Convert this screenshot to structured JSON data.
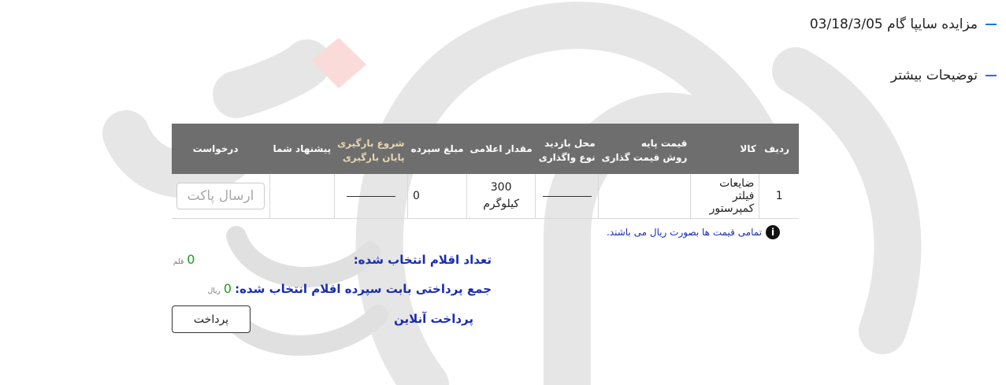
{
  "auction": {
    "title": "مزایده سایپا گام 03/18/3/05",
    "more_info": "توضیحات بیشتر"
  },
  "table": {
    "headers": {
      "row": "ردیف",
      "item": "کالا",
      "base_price": "قیمت پایه",
      "pricing_method": "روش قیمت گذاری",
      "visit_place": "محل بازدید",
      "assign_type": "نوع واگذاری",
      "quantity": "مقدار اعلامی",
      "deposit": "مبلغ سپرده",
      "load_start": "شروع بارگیری",
      "load_end": "پایان بارگیری",
      "your_offer": "پیشنهاد شما",
      "request": "درخواست"
    },
    "rows": [
      {
        "row": "1",
        "item": "ضایعات فیلتر کمپرستور",
        "base_price": "",
        "quantity_value": "300",
        "quantity_unit": "کیلوگرم",
        "deposit": "0",
        "offer": "",
        "action": "ارسال پاکت"
      }
    ]
  },
  "note": "تمامی قیمت ها بصورت ریال می باشند.",
  "summary": {
    "count_label": "تعداد اقلام انتخاب شده:",
    "count_value": "0",
    "count_unit": "قلم",
    "deposit_label": "جمع پرداختی بابت سپرده اقلام انتخاب شده:",
    "deposit_value": "0",
    "deposit_unit": "ریال",
    "online_label": "پرداخت آنلاین",
    "pay_button": "پرداخت"
  },
  "colors": {
    "accent": "#1a73e8",
    "header_bg": "#6e6e6e",
    "label_blue": "#1a2db0",
    "value_green": "#1e9b1e"
  }
}
